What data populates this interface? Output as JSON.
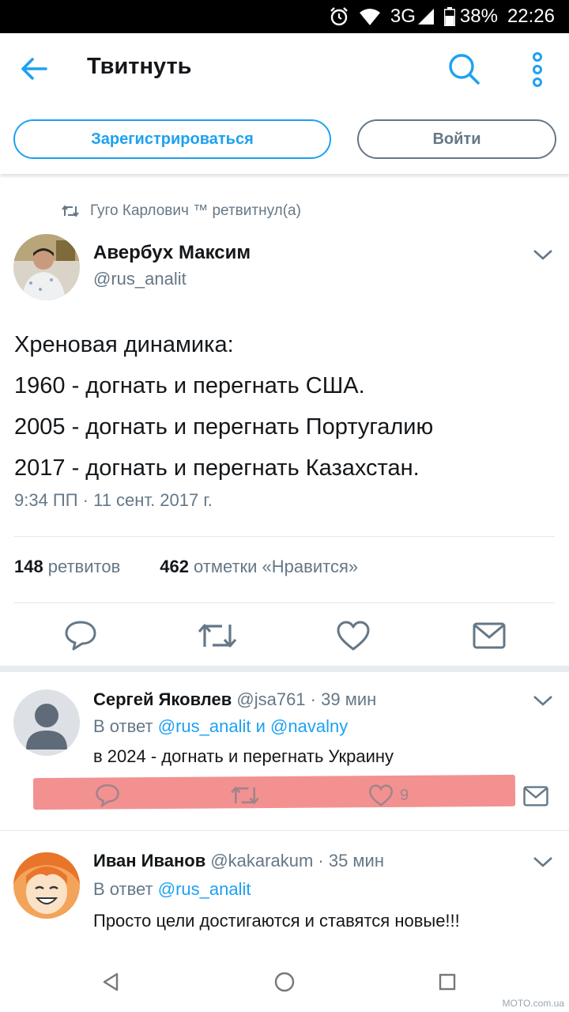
{
  "status_bar": {
    "network": "3G",
    "battery": "38%",
    "time": "22:26",
    "icons": [
      "alarm-icon",
      "wifi-icon",
      "signal-icon",
      "battery-icon"
    ]
  },
  "header": {
    "title": "Твитнуть",
    "signup_label": "Зарегистрироваться",
    "login_label": "Войти",
    "icons": [
      "back-arrow-icon",
      "search-icon",
      "more-vertical-icon"
    ]
  },
  "tweet": {
    "retweeted_by": "Гуго Карлович ™ ретвитнул(а)",
    "author_name": "Авербух Максим",
    "author_handle": "@rus_analit",
    "text_lines": [
      "Хреновая динамика:",
      "1960 - догнать и перегнать США.",
      "2005 - догнать и перегнать Португалию",
      "2017 - догнать и перегнать Казахстан."
    ],
    "timestamp": "9:34 ПП · 11 сент. 2017 г.",
    "retweets_count": "148",
    "retweets_label": "ретвитов",
    "likes_count": "462",
    "likes_label": "отметки «Нравится»"
  },
  "replies": [
    {
      "author_name": "Сергей Яковлев",
      "author_handle": "@jsa761",
      "time": "· 39 мин",
      "reply_prefix": "В ответ",
      "reply_to_1": "@rus_analit",
      "reply_joiner": "и",
      "reply_to_2": "@navalny",
      "text": "в 2024 - догнать и перегнать Украину",
      "like_count": "9"
    },
    {
      "author_name": "Иван Иванов",
      "author_handle": "@kakarakum",
      "time": "· 35 мин",
      "reply_prefix": "В ответ",
      "reply_to_1": "@rus_analit",
      "text": "Просто цели достигаются и ставятся новые!!!"
    }
  ],
  "watermark": "MOTO.com.ua",
  "colors": {
    "accent": "#1da1f2",
    "secondary_text": "#657786",
    "primary_text": "#14171a",
    "highlight_mark": "#f28b8b"
  }
}
